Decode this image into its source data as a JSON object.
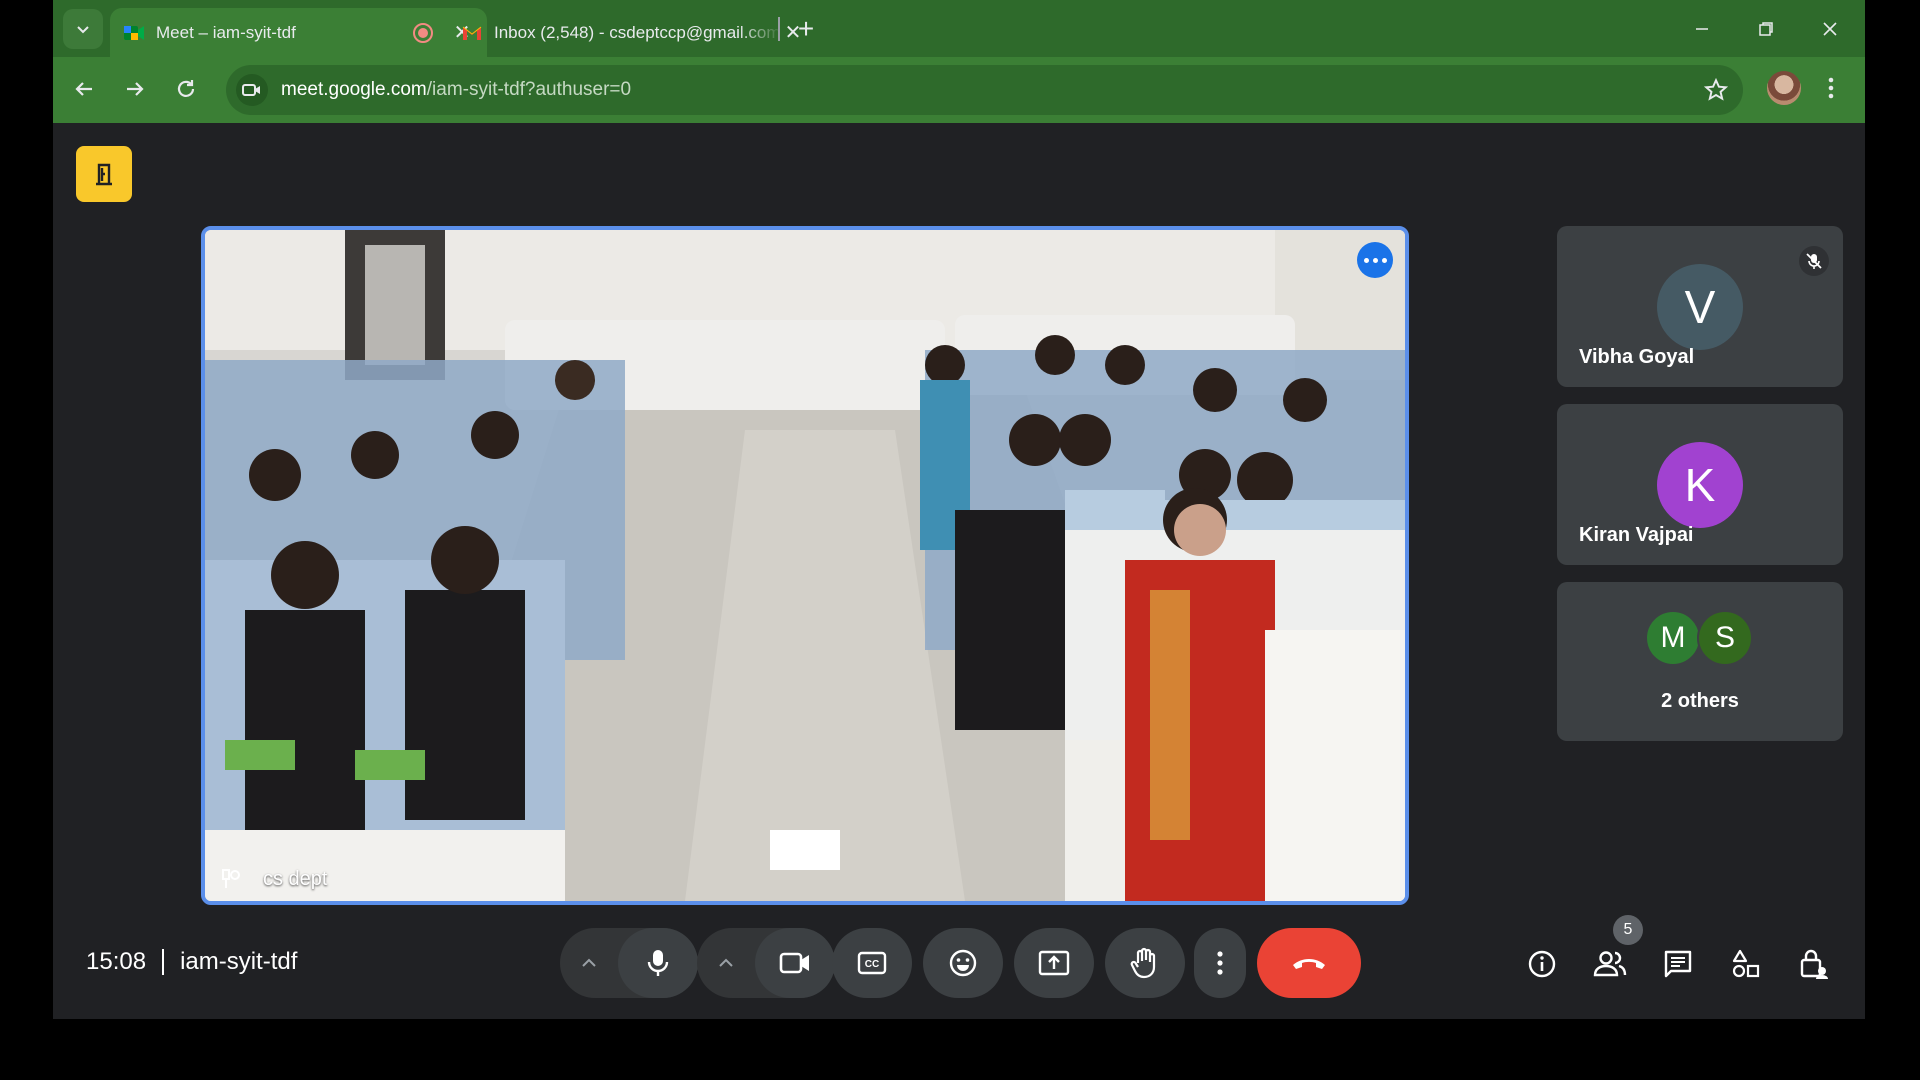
{
  "tabs": [
    {
      "title": "Meet – iam-syit-tdf",
      "favicon": "google-meet-icon",
      "recording": true
    },
    {
      "title": "Inbox (2,548) - csdeptccp@gmail.com",
      "favicon": "gmail-icon"
    }
  ],
  "address_bar": {
    "host": "meet.google.com",
    "path": "/iam-syit-tdf?authuser=0"
  },
  "main_tile": {
    "participant_name": "cs dept",
    "more_options_icon": "more-horizontal-icon"
  },
  "participants": [
    {
      "initial": "V",
      "name": "Vibha Goyal",
      "avatar_color": "#455a64",
      "muted": true
    },
    {
      "initial": "K",
      "name": "Kiran Vajpai",
      "avatar_color": "#a142d0",
      "muted": false
    }
  ],
  "others": {
    "initials": [
      "M",
      "S"
    ],
    "colors": [
      "#2e7d32",
      "#33691e"
    ],
    "label": "2 others"
  },
  "meeting": {
    "time": "15:08",
    "code": "iam-syit-tdf"
  },
  "people_count": "5",
  "colors": {
    "browser_frame": "#2e6a2b",
    "toolbar": "#3b7f35",
    "meet_bg": "#202124",
    "active_speaker_border": "#5b8fea",
    "end_call": "#ea4335"
  }
}
